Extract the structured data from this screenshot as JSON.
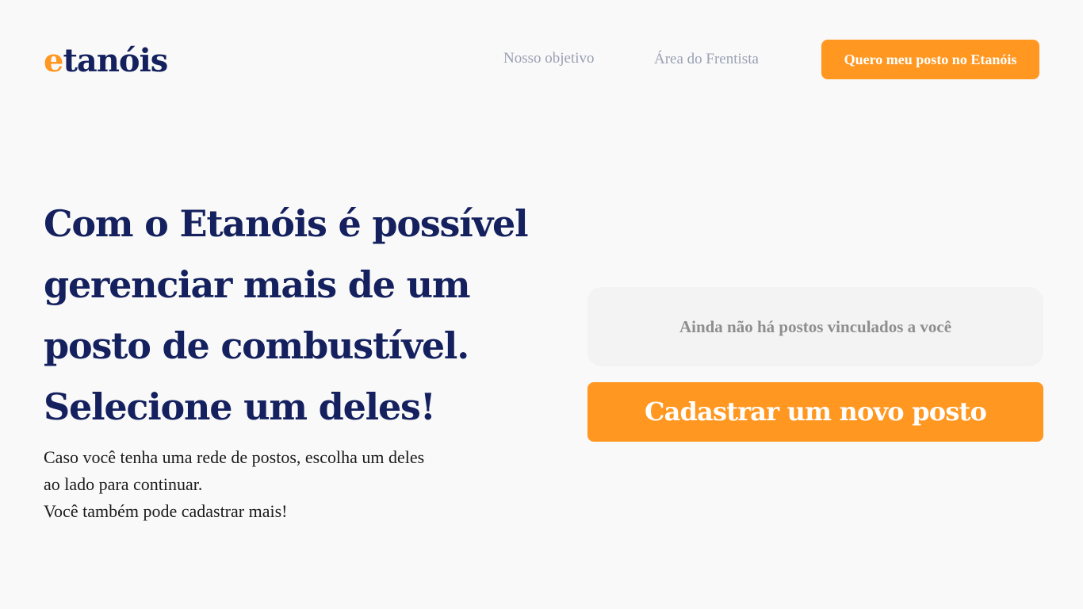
{
  "header": {
    "logo_accent": "e",
    "logo_rest": "tanóis",
    "nav": {
      "objetivo": "Nosso objetivo",
      "frentista": "Área do Frentista"
    },
    "cta_label": "Quero meu posto no Etanóis"
  },
  "hero": {
    "title_lines": [
      "Com o Etanóis é possível",
      "gerenciar mais de um",
      "posto de combustível.",
      "Selecione um deles!"
    ],
    "description_lines": [
      "Caso você tenha uma rede de postos, escolha um deles",
      "ao lado para continuar.",
      "Você também pode cadastrar mais!"
    ]
  },
  "stations": {
    "empty_message": "Ainda não há postos vinculados a você",
    "register_button": "Cadastrar um novo posto"
  },
  "colors": {
    "brand_navy": "#14215e",
    "brand_orange": "#ff9720",
    "background": "#f9f9f9",
    "nav_text": "#9aa0b4"
  }
}
